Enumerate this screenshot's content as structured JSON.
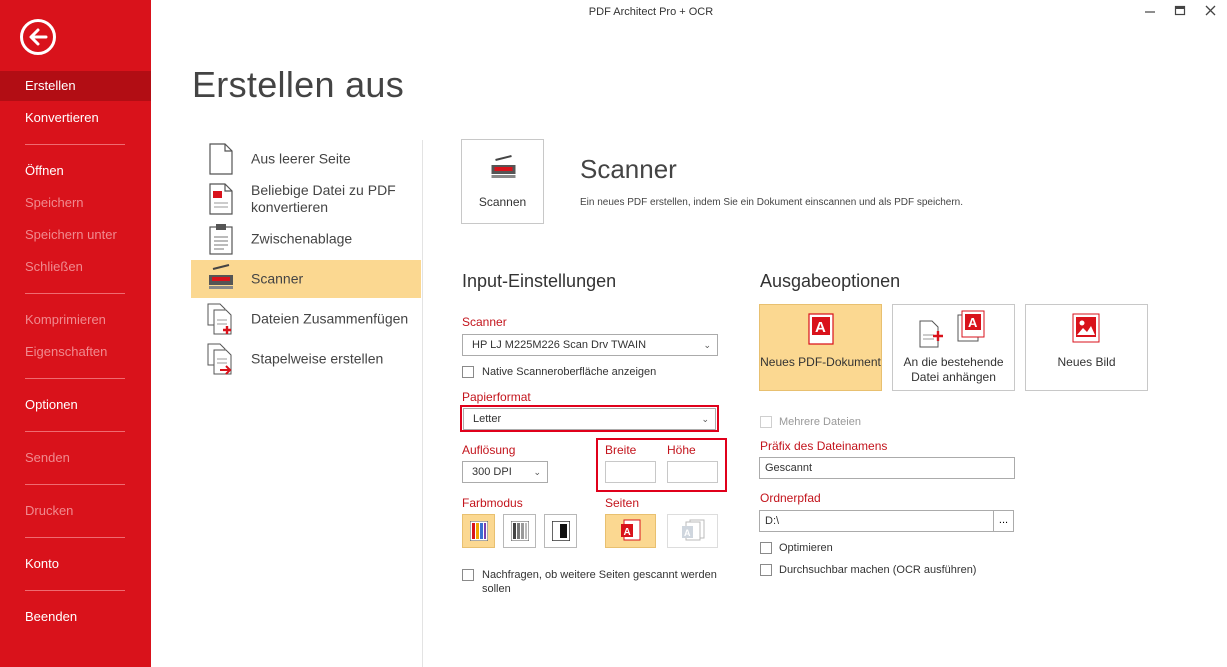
{
  "window": {
    "title": "PDF Architect Pro + OCR",
    "minimize": "—",
    "maximize": "□",
    "close": "✕"
  },
  "sidebar": {
    "items": [
      {
        "label": "Erstellen",
        "active": true,
        "disabled": false
      },
      {
        "label": "Konvertieren",
        "active": false,
        "disabled": false
      },
      {
        "label": "Öffnen",
        "active": false,
        "disabled": false
      },
      {
        "label": "Speichern",
        "active": false,
        "disabled": true
      },
      {
        "label": "Speichern unter",
        "active": false,
        "disabled": true
      },
      {
        "label": "Schließen",
        "active": false,
        "disabled": true
      },
      {
        "label": "Komprimieren",
        "active": false,
        "disabled": true
      },
      {
        "label": "Eigenschaften",
        "active": false,
        "disabled": true
      },
      {
        "label": "Optionen",
        "active": false,
        "disabled": false
      },
      {
        "label": "Senden",
        "active": false,
        "disabled": true
      },
      {
        "label": "Drucken",
        "active": false,
        "disabled": true
      },
      {
        "label": "Konto",
        "active": false,
        "disabled": false
      },
      {
        "label": "Beenden",
        "active": false,
        "disabled": false
      }
    ]
  },
  "page": {
    "title": "Erstellen aus"
  },
  "create_options": [
    {
      "label": "Aus leerer Seite",
      "icon": "blank-page-icon",
      "selected": false
    },
    {
      "label": "Beliebige Datei zu PDF konvertieren",
      "icon": "file-to-pdf-icon",
      "selected": false
    },
    {
      "label": "Zwischenablage",
      "icon": "clipboard-icon",
      "selected": false
    },
    {
      "label": "Scanner",
      "icon": "scanner-icon",
      "selected": true
    },
    {
      "label": "Dateien Zusammenfügen",
      "icon": "merge-files-icon",
      "selected": false
    },
    {
      "label": "Stapelweise erstellen",
      "icon": "batch-create-icon",
      "selected": false
    }
  ],
  "scanner": {
    "tile_label": "Scannen",
    "heading": "Scanner",
    "description": "Ein neues PDF erstellen, indem Sie ein Dokument einscannen und als PDF speichern."
  },
  "input": {
    "title": "Input-Einstellungen",
    "scanner_label": "Scanner",
    "scanner_value": "HP LJ M225M226 Scan Drv TWAIN",
    "native_label": "Native Scanneroberfläche anzeigen",
    "paper_label": "Papierformat",
    "paper_value": "Letter",
    "resolution_label": "Auflösung",
    "resolution_value": "300 DPI",
    "width_label": "Breite",
    "height_label": "Höhe",
    "color_label": "Farbmodus",
    "pages_label": "Seiten",
    "ask_more_label": "Nachfragen, ob weitere Seiten gescannt werden sollen"
  },
  "output": {
    "title": "Ausgabeoptionen",
    "tiles": [
      {
        "label": "Neues PDF-Dokument",
        "selected": true
      },
      {
        "label": "An die bestehende Datei anhängen",
        "selected": false
      },
      {
        "label": "Neues Bild",
        "selected": false
      }
    ],
    "multiple_files_label": "Mehrere Dateien",
    "prefix_label": "Präfix des Dateinamens",
    "prefix_value": "Gescannt",
    "folder_label": "Ordnerpfad",
    "folder_value": "D:\\",
    "browse_label": "...",
    "optimize_label": "Optimieren",
    "ocr_label": "Durchsuchbar machen (OCR ausführen)"
  },
  "colors": {
    "accent": "#d9121b",
    "selected": "#fbd891",
    "highlight_box": "#e0001b"
  }
}
